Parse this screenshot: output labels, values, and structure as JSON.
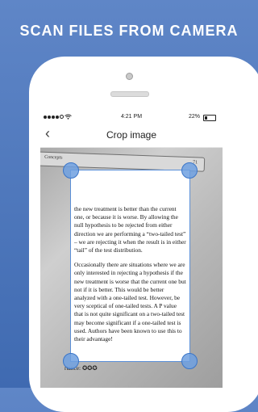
{
  "promo": {
    "headline": "SCAN FILES FROM CAMERA"
  },
  "status_bar": {
    "time": "4:21 PM",
    "battery": "22%"
  },
  "nav": {
    "back_icon": "chevron-left-icon",
    "back_glyph": "‹",
    "title": "Crop image"
  },
  "photo": {
    "tab_label": "Concepts",
    "tab_page": "71",
    "paragraphs": [
      "the new treatment is better than the current one, or because it is worse. By allowing the null hypothesis to be rejected from either direction we are performing a “two-tailed test” – we are rejecting it when the result is in either “tail” of the test distribution.",
      "Occasionally there are situations where we are only interested in rejecting a hypothesis if the new treatment is worse that the current one but not if it is better. This would be better analyzed with a one-tailed test. However, be very sceptical of one-tailed tests. A P value that is not quite significant on a two-tailed test may become significant if a one-tailed test is used. Authors have been known to use this to their advantage!"
    ],
    "bottom_line": "rtance: ✪✪✪"
  },
  "crop_handles": [
    "top-left",
    "top-right",
    "bottom-left",
    "bottom-right"
  ],
  "colors": {
    "background": "#4f78bd",
    "handle": "#6ea0e1",
    "crop_border": "#5a8fd8"
  }
}
